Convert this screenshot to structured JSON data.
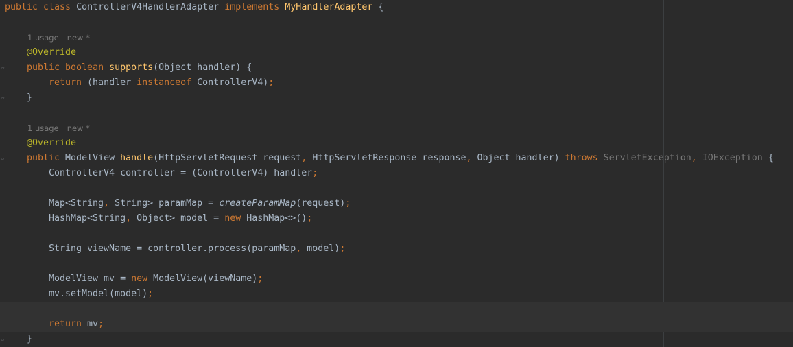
{
  "editor": {
    "lines": [
      {
        "indent": 0,
        "tokens": [
          [
            "kw",
            "public class "
          ],
          [
            "pl",
            "ControllerV4HandlerAdapter "
          ],
          [
            "kw",
            "implements "
          ],
          [
            "fn",
            "MyHandlerAdapter "
          ],
          [
            "pl",
            "{"
          ]
        ]
      },
      {
        "indent": 0,
        "tokens": []
      },
      {
        "hint": true,
        "usages": "1 usage",
        "status": "new *"
      },
      {
        "indent": 1,
        "tokens": [
          [
            "ann",
            "@Override"
          ]
        ]
      },
      {
        "indent": 1,
        "fold": true,
        "tokens": [
          [
            "kw",
            "public boolean "
          ],
          [
            "fn",
            "supports"
          ],
          [
            "pl",
            "(Object handler) {"
          ]
        ]
      },
      {
        "indent": 2,
        "tokens": [
          [
            "kw",
            "return "
          ],
          [
            "pl",
            "(handler "
          ],
          [
            "kw",
            "instanceof "
          ],
          [
            "pl",
            "ControllerV4)"
          ],
          [
            "kw",
            ";"
          ]
        ]
      },
      {
        "indent": 1,
        "fold": true,
        "tokens": [
          [
            "pl",
            "}"
          ]
        ]
      },
      {
        "indent": 0,
        "tokens": []
      },
      {
        "hint": true,
        "usages": "1 usage",
        "status": "new *"
      },
      {
        "indent": 1,
        "tokens": [
          [
            "ann",
            "@Override"
          ]
        ]
      },
      {
        "indent": 1,
        "fold": true,
        "tokens": [
          [
            "kw",
            "public "
          ],
          [
            "pl",
            "ModelView "
          ],
          [
            "fn",
            "handle"
          ],
          [
            "pl",
            "(HttpServletRequest request"
          ],
          [
            "kw",
            ", "
          ],
          [
            "pl",
            "HttpServletResponse response"
          ],
          [
            "kw",
            ", "
          ],
          [
            "pl",
            "Object handler) "
          ],
          [
            "kw",
            "throws "
          ],
          [
            "dim",
            "ServletException"
          ],
          [
            "kw",
            ", "
          ],
          [
            "dim",
            "IOException "
          ],
          [
            "pl",
            "{"
          ]
        ]
      },
      {
        "indent": 2,
        "tokens": [
          [
            "pl",
            "ControllerV4 controller = (ControllerV4) handler"
          ],
          [
            "kw",
            ";"
          ]
        ]
      },
      {
        "indent": 0,
        "tokens": []
      },
      {
        "indent": 2,
        "tokens": [
          [
            "pl",
            "Map<String"
          ],
          [
            "kw",
            ", "
          ],
          [
            "pl",
            "String> paramMap = "
          ],
          [
            "it",
            "createParamMap"
          ],
          [
            "pl",
            "(request)"
          ],
          [
            "kw",
            ";"
          ]
        ]
      },
      {
        "indent": 2,
        "tokens": [
          [
            "pl",
            "HashMap<String"
          ],
          [
            "kw",
            ", "
          ],
          [
            "pl",
            "Object> model = "
          ],
          [
            "kw",
            "new "
          ],
          [
            "pl",
            "HashMap<>()"
          ],
          [
            "kw",
            ";"
          ]
        ]
      },
      {
        "indent": 0,
        "tokens": []
      },
      {
        "indent": 2,
        "tokens": [
          [
            "pl",
            "String viewName = controller.process(paramMap"
          ],
          [
            "kw",
            ", "
          ],
          [
            "pl",
            "model)"
          ],
          [
            "kw",
            ";"
          ]
        ]
      },
      {
        "indent": 0,
        "tokens": []
      },
      {
        "indent": 2,
        "tokens": [
          [
            "pl",
            "ModelView mv = "
          ],
          [
            "kw",
            "new "
          ],
          [
            "pl",
            "ModelView(viewName)"
          ],
          [
            "kw",
            ";"
          ]
        ]
      },
      {
        "indent": 2,
        "tokens": [
          [
            "pl",
            "mv.setModel(model)"
          ],
          [
            "kw",
            ";"
          ]
        ]
      },
      {
        "indent": 0,
        "tokens": [],
        "current": true
      },
      {
        "indent": 2,
        "tokens": [
          [
            "kw",
            "return "
          ],
          [
            "pl",
            "mv"
          ],
          [
            "kw",
            ";"
          ]
        ],
        "current": true
      },
      {
        "indent": 1,
        "fold": true,
        "tokens": [
          [
            "pl",
            "}"
          ]
        ]
      }
    ]
  }
}
